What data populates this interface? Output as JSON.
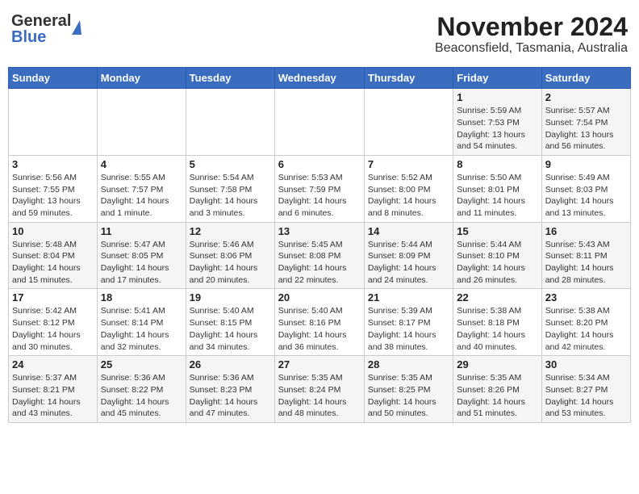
{
  "header": {
    "logo_line1": "General",
    "logo_line2": "Blue",
    "title": "November 2024",
    "subtitle": "Beaconsfield, Tasmania, Australia"
  },
  "calendar": {
    "days_of_week": [
      "Sunday",
      "Monday",
      "Tuesday",
      "Wednesday",
      "Thursday",
      "Friday",
      "Saturday"
    ],
    "weeks": [
      [
        {
          "day": "",
          "info": ""
        },
        {
          "day": "",
          "info": ""
        },
        {
          "day": "",
          "info": ""
        },
        {
          "day": "",
          "info": ""
        },
        {
          "day": "",
          "info": ""
        },
        {
          "day": "1",
          "info": "Sunrise: 5:59 AM\nSunset: 7:53 PM\nDaylight: 13 hours\nand 54 minutes."
        },
        {
          "day": "2",
          "info": "Sunrise: 5:57 AM\nSunset: 7:54 PM\nDaylight: 13 hours\nand 56 minutes."
        }
      ],
      [
        {
          "day": "3",
          "info": "Sunrise: 5:56 AM\nSunset: 7:55 PM\nDaylight: 13 hours\nand 59 minutes."
        },
        {
          "day": "4",
          "info": "Sunrise: 5:55 AM\nSunset: 7:57 PM\nDaylight: 14 hours\nand 1 minute."
        },
        {
          "day": "5",
          "info": "Sunrise: 5:54 AM\nSunset: 7:58 PM\nDaylight: 14 hours\nand 3 minutes."
        },
        {
          "day": "6",
          "info": "Sunrise: 5:53 AM\nSunset: 7:59 PM\nDaylight: 14 hours\nand 6 minutes."
        },
        {
          "day": "7",
          "info": "Sunrise: 5:52 AM\nSunset: 8:00 PM\nDaylight: 14 hours\nand 8 minutes."
        },
        {
          "day": "8",
          "info": "Sunrise: 5:50 AM\nSunset: 8:01 PM\nDaylight: 14 hours\nand 11 minutes."
        },
        {
          "day": "9",
          "info": "Sunrise: 5:49 AM\nSunset: 8:03 PM\nDaylight: 14 hours\nand 13 minutes."
        }
      ],
      [
        {
          "day": "10",
          "info": "Sunrise: 5:48 AM\nSunset: 8:04 PM\nDaylight: 14 hours\nand 15 minutes."
        },
        {
          "day": "11",
          "info": "Sunrise: 5:47 AM\nSunset: 8:05 PM\nDaylight: 14 hours\nand 17 minutes."
        },
        {
          "day": "12",
          "info": "Sunrise: 5:46 AM\nSunset: 8:06 PM\nDaylight: 14 hours\nand 20 minutes."
        },
        {
          "day": "13",
          "info": "Sunrise: 5:45 AM\nSunset: 8:08 PM\nDaylight: 14 hours\nand 22 minutes."
        },
        {
          "day": "14",
          "info": "Sunrise: 5:44 AM\nSunset: 8:09 PM\nDaylight: 14 hours\nand 24 minutes."
        },
        {
          "day": "15",
          "info": "Sunrise: 5:44 AM\nSunset: 8:10 PM\nDaylight: 14 hours\nand 26 minutes."
        },
        {
          "day": "16",
          "info": "Sunrise: 5:43 AM\nSunset: 8:11 PM\nDaylight: 14 hours\nand 28 minutes."
        }
      ],
      [
        {
          "day": "17",
          "info": "Sunrise: 5:42 AM\nSunset: 8:12 PM\nDaylight: 14 hours\nand 30 minutes."
        },
        {
          "day": "18",
          "info": "Sunrise: 5:41 AM\nSunset: 8:14 PM\nDaylight: 14 hours\nand 32 minutes."
        },
        {
          "day": "19",
          "info": "Sunrise: 5:40 AM\nSunset: 8:15 PM\nDaylight: 14 hours\nand 34 minutes."
        },
        {
          "day": "20",
          "info": "Sunrise: 5:40 AM\nSunset: 8:16 PM\nDaylight: 14 hours\nand 36 minutes."
        },
        {
          "day": "21",
          "info": "Sunrise: 5:39 AM\nSunset: 8:17 PM\nDaylight: 14 hours\nand 38 minutes."
        },
        {
          "day": "22",
          "info": "Sunrise: 5:38 AM\nSunset: 8:18 PM\nDaylight: 14 hours\nand 40 minutes."
        },
        {
          "day": "23",
          "info": "Sunrise: 5:38 AM\nSunset: 8:20 PM\nDaylight: 14 hours\nand 42 minutes."
        }
      ],
      [
        {
          "day": "24",
          "info": "Sunrise: 5:37 AM\nSunset: 8:21 PM\nDaylight: 14 hours\nand 43 minutes."
        },
        {
          "day": "25",
          "info": "Sunrise: 5:36 AM\nSunset: 8:22 PM\nDaylight: 14 hours\nand 45 minutes."
        },
        {
          "day": "26",
          "info": "Sunrise: 5:36 AM\nSunset: 8:23 PM\nDaylight: 14 hours\nand 47 minutes."
        },
        {
          "day": "27",
          "info": "Sunrise: 5:35 AM\nSunset: 8:24 PM\nDaylight: 14 hours\nand 48 minutes."
        },
        {
          "day": "28",
          "info": "Sunrise: 5:35 AM\nSunset: 8:25 PM\nDaylight: 14 hours\nand 50 minutes."
        },
        {
          "day": "29",
          "info": "Sunrise: 5:35 AM\nSunset: 8:26 PM\nDaylight: 14 hours\nand 51 minutes."
        },
        {
          "day": "30",
          "info": "Sunrise: 5:34 AM\nSunset: 8:27 PM\nDaylight: 14 hours\nand 53 minutes."
        }
      ]
    ]
  }
}
